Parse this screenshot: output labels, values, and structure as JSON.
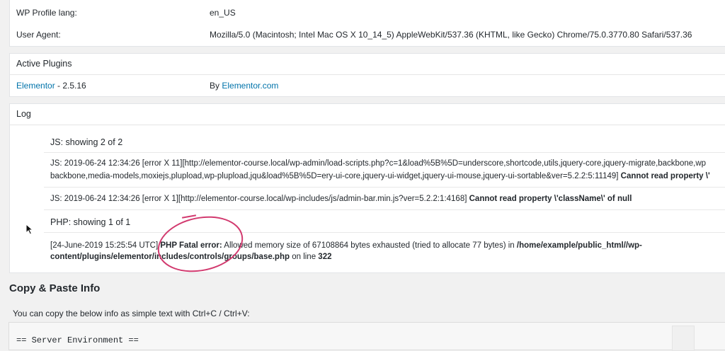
{
  "system_info": {
    "rows": [
      {
        "label": "WP Profile lang:",
        "value": "en_US"
      },
      {
        "label": "User Agent:",
        "value": "Mozilla/5.0 (Macintosh; Intel Mac OS X 10_14_5) AppleWebKit/537.36 (KHTML, like Gecko) Chrome/75.0.3770.80 Safari/537.36"
      }
    ]
  },
  "active_plugins": {
    "heading": "Active Plugins",
    "plugin_name": "Elementor",
    "plugin_version": " - 2.5.16",
    "by_prefix": "By ",
    "author": "Elementor.com"
  },
  "log": {
    "heading": "Log",
    "js_heading": "JS: showing 2 of 2",
    "js_entries": [
      {
        "line1": "JS: 2019-06-24 12:34:26 [error X 11][http://elementor-course.local/wp-admin/load-scripts.php?c=1&load%5B%5D=underscore,shortcode,utils,jquery-core,jquery-migrate,backbone,wp",
        "line2_text": "backbone,media-models,moxiejs,plupload,wp-plupload,jqu&load%5B%5D=ery-ui-core,jquery-ui-widget,jquery-ui-mouse,jquery-ui-sortable&ver=5.2.2:5:11149] ",
        "line2_bold": "Cannot read property \\'"
      },
      {
        "line1_text": "JS: 2019-06-24 12:34:26 [error X 1][http://elementor-course.local/wp-includes/js/admin-bar.min.js?ver=5.2.2:1:4168] ",
        "line1_bold": "Cannot read property \\'className\\' of null"
      }
    ],
    "php_heading": "PHP: showing 1 of 1",
    "php_entry": {
      "date": "[24-June-2019 15:25:54 UTC] ",
      "error_label": "PHP Fatal error:",
      "message": " Allowed memory size of 67108864 bytes exhausted (tried to allocate 77 bytes) in ",
      "path_1": "/home/example/public_html//wp-",
      "path_2": "content/plugins/elementor/includes/controls/groups/base.php",
      "on_line": " on line ",
      "line_no": "322"
    }
  },
  "copy_paste": {
    "title": "Copy & Paste Info",
    "description": "You can copy the below info as simple text with Ctrl+C / Ctrl+V:",
    "textarea_first_line": "== Server Environment =="
  },
  "colors": {
    "link": "#0073aa",
    "annotation": "#d23a6f"
  }
}
